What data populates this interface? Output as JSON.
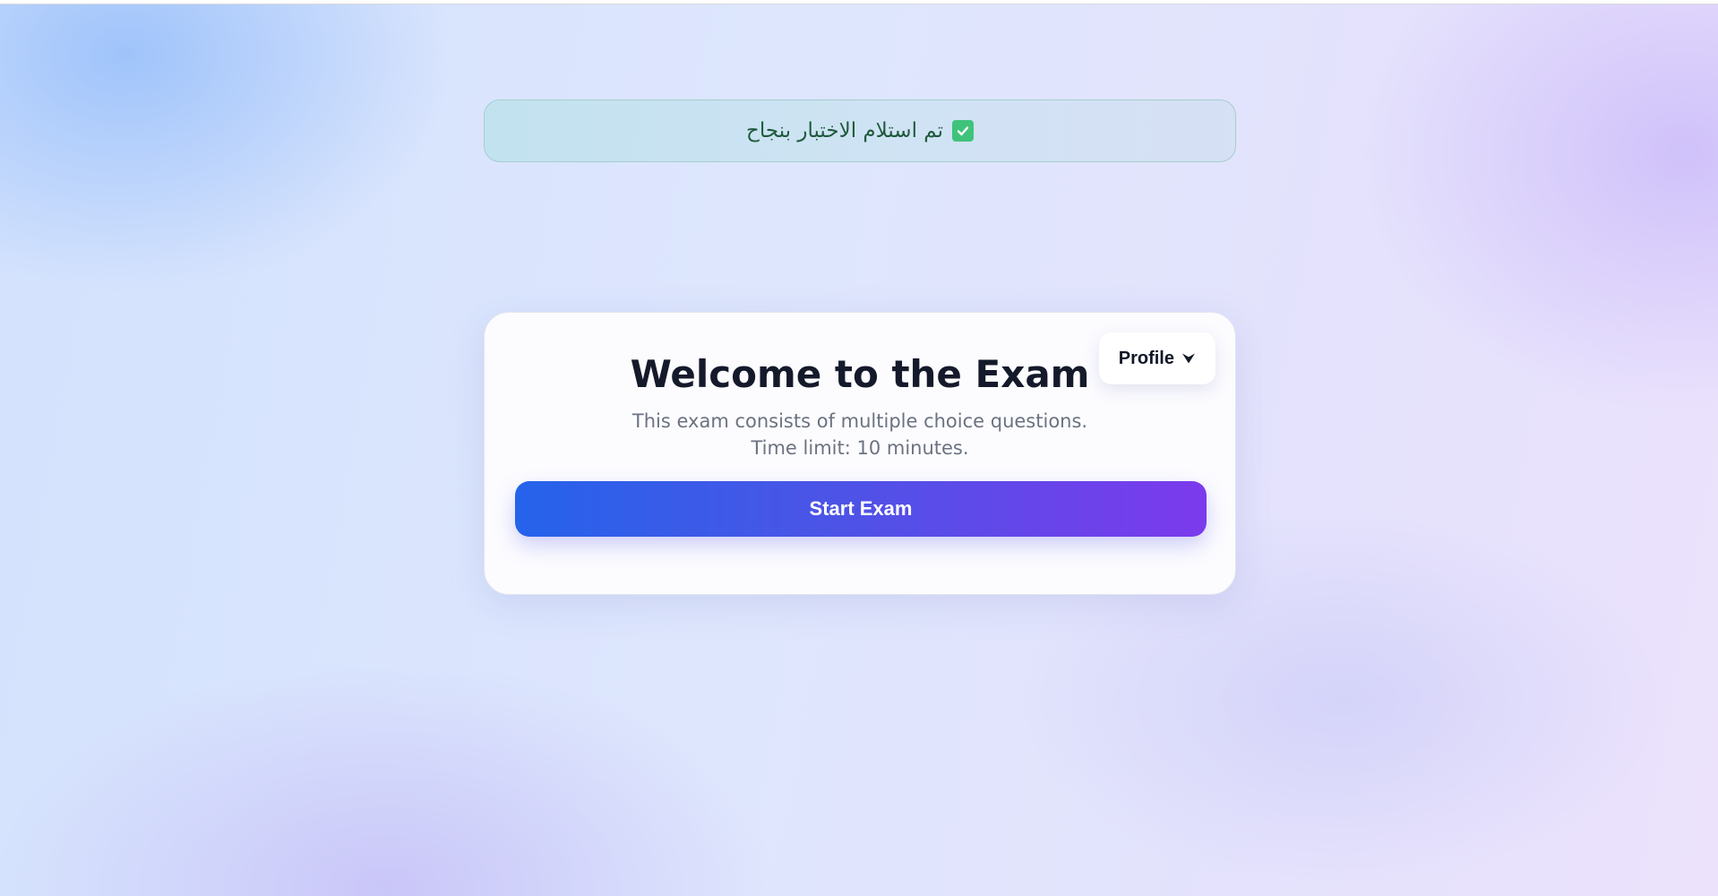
{
  "alert": {
    "message": "تم استلام الاختبار بنجاح",
    "icon": "check-icon",
    "color": "#1f5a3c"
  },
  "card": {
    "title": "Welcome to the Exam",
    "description_line1": "This exam consists of multiple choice questions.",
    "description_line2": "Time limit: 10 minutes.",
    "start_button_label": "Start Exam",
    "accent_start": "#2563eb",
    "accent_end": "#7c3aed"
  },
  "profile": {
    "label": "Profile",
    "icon": "chevron-down-icon"
  }
}
